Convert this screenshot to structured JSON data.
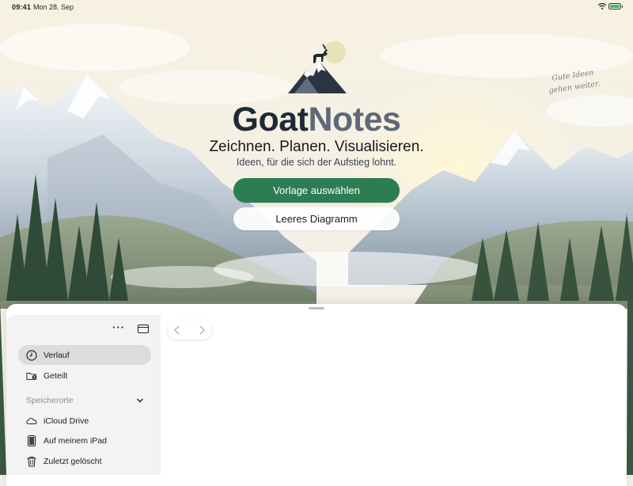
{
  "status_bar": {
    "time": "09:41",
    "date": "Mon 28. Sep"
  },
  "hero": {
    "brand_part1": "Goat",
    "brand_part2": "Notes",
    "tagline": "Zeichnen. Planen. Visualisieren.",
    "subline": "Ideen, für die sich der Aufstieg lohnt.",
    "handwritten_note_line1": "Gute Ideen",
    "handwritten_note_line2": "gehen weiter.",
    "primary_button": "Vorlage auswählen",
    "secondary_button": "Leeres Diagramm",
    "colors": {
      "primary": "#2c7d54",
      "brand_dark": "#1f2a36",
      "brand_light": "#5e6878"
    }
  },
  "sidebar": {
    "more_icon": "ellipsis-icon",
    "toggle_icon": "sidebar-toggle-icon",
    "items": [
      {
        "label": "Verlauf",
        "icon": "clock-icon",
        "selected": true
      },
      {
        "label": "Geteilt",
        "icon": "shared-folder-icon",
        "selected": false
      }
    ],
    "locations_header": "Speicherorte",
    "locations": [
      {
        "label": "iCloud Drive",
        "icon": "cloud-icon"
      },
      {
        "label": "Auf meinem iPad",
        "icon": "ipad-icon"
      },
      {
        "label": "Zuletzt gelöscht",
        "icon": "trash-icon"
      }
    ]
  },
  "toolbar": {
    "back_icon": "chevron-left-icon",
    "forward_icon": "chevron-right-icon"
  }
}
